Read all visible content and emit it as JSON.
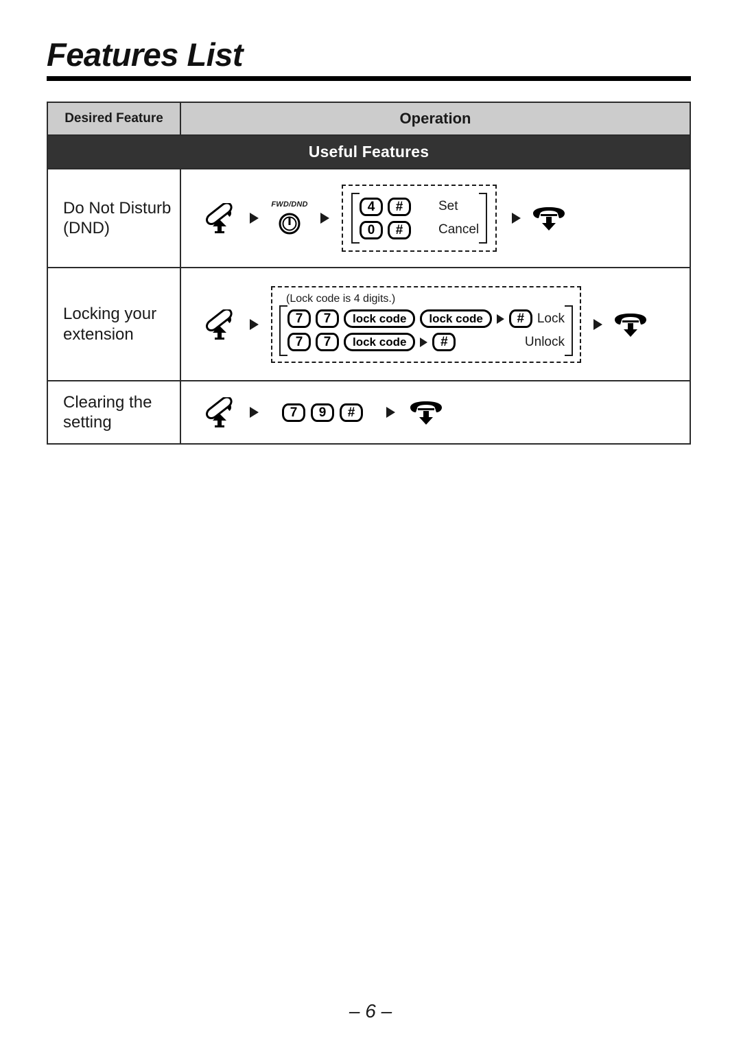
{
  "page": {
    "title": "Features List",
    "number": "– 6 –"
  },
  "table": {
    "headers": {
      "feature": "Desired Feature",
      "operation": "Operation"
    },
    "section_band": "Useful Features",
    "rows": [
      {
        "feature_line1": "Do Not Disturb",
        "feature_line2": "(DND)",
        "fwd_dnd_label": "FWD/DND",
        "group": {
          "lines": [
            {
              "keys": [
                "4",
                "#"
              ],
              "label": "Set"
            },
            {
              "keys": [
                "0",
                "#"
              ],
              "label": "Cancel"
            }
          ]
        }
      },
      {
        "feature_line1": "Locking your",
        "feature_line2": "extension",
        "note": "(Lock code is 4 digits.)",
        "group": {
          "lines": [
            {
              "keys": [
                "7",
                "7",
                "lock code",
                "lock code"
              ],
              "arrow_key": "#",
              "label": "Lock"
            },
            {
              "keys": [
                "7",
                "7",
                "lock code"
              ],
              "arrow_key": "#",
              "label": "Unlock"
            }
          ]
        }
      },
      {
        "feature_line1": "Clearing the",
        "feature_line2": "setting",
        "keys": [
          "7",
          "9",
          "#"
        ]
      }
    ]
  },
  "icons": {
    "offhook": "offhook-handset-icon",
    "onhook": "onhook-handset-icon",
    "fwd_dnd_button": "fwd-dnd-button-icon",
    "arrow": "arrow-right-icon"
  }
}
